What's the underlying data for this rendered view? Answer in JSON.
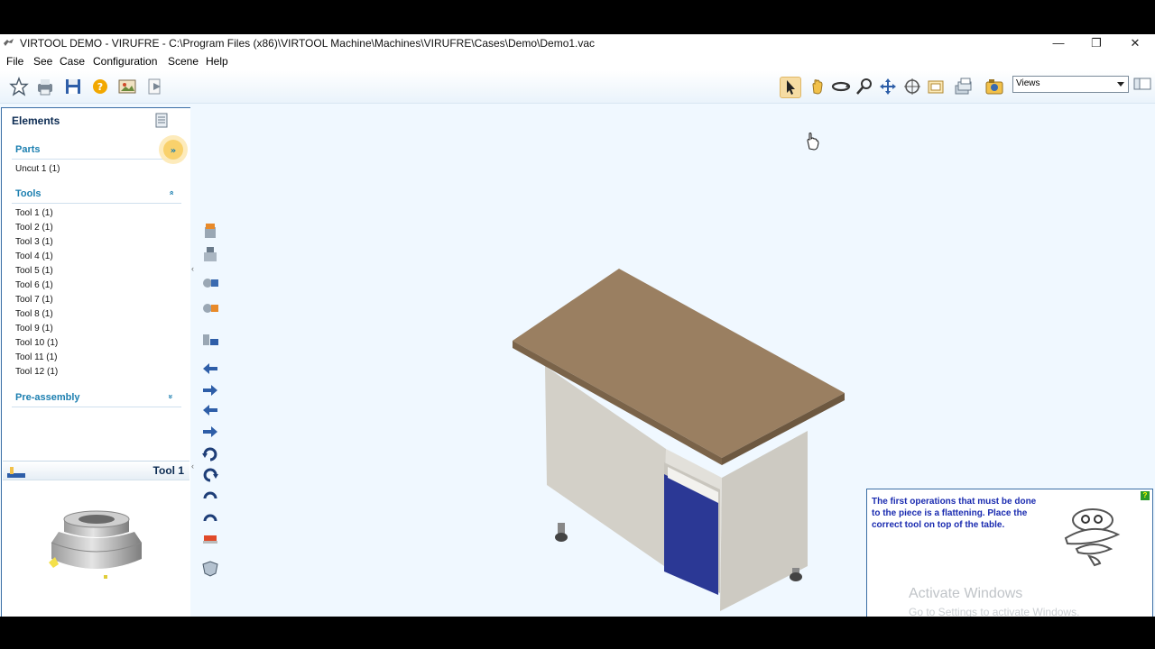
{
  "window": {
    "title": "VIRTOOL DEMO - VIRUFRE - C:\\Program Files (x86)\\VIRTOOL Machine\\Machines\\VIRUFRE\\Cases\\Demo\\Demo1.vac",
    "minimize_glyph": "—",
    "restore_glyph": "❐",
    "close_glyph": "✕"
  },
  "menu": [
    "File",
    "See",
    "Case",
    "Configuration",
    "Scene",
    "Help"
  ],
  "toolbar": {
    "left_icons": [
      "favorite-icon",
      "print-icon",
      "save-icon",
      "help-icon",
      "image-icon",
      "play-icon"
    ],
    "right_icons": [
      "select-pointer-icon",
      "hand-pan-icon",
      "rotate-icon",
      "zoom-icon",
      "move-icon",
      "target-icon",
      "fit-view-icon",
      "layers-icon",
      "camera-icon"
    ],
    "views_select": "Views"
  },
  "elements_panel": {
    "title": "Elements",
    "parts_header": "Parts",
    "parts": [
      "Uncut 1 (1)"
    ],
    "tools_header": "Tools",
    "tools": [
      "Tool 1 (1)",
      "Tool 2 (1)",
      "Tool 3 (1)",
      "Tool 4 (1)",
      "Tool 5 (1)",
      "Tool 6 (1)",
      "Tool 7 (1)",
      "Tool 8 (1)",
      "Tool 9 (1)",
      "Tool 10 (1)",
      "Tool 11 (1)",
      "Tool 12 (1)"
    ],
    "preassembly_header": "Pre-assembly",
    "selected_tool_label": "Tool 1"
  },
  "hint_box": {
    "text": "The first operations that must be done to the piece is a flattening. Place the correct tool on top of the table.",
    "help_glyph": "?"
  },
  "watermark": {
    "title": "Activate Windows",
    "subtitle": "Go to Settings to activate Windows."
  },
  "colors": {
    "viewport_bg": "#f0f8ff",
    "panel_border": "#3b6ea5",
    "section_header": "#1c7fb0",
    "hint_text": "#1a2bb0",
    "table_top": "#9a7f61",
    "cabinet": "#d8d6d0",
    "door": "#2b3895"
  }
}
